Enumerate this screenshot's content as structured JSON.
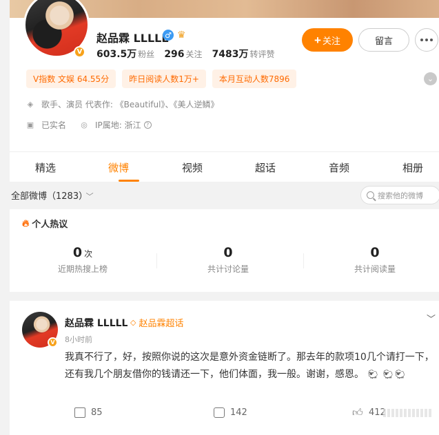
{
  "profile": {
    "name": "赵品霖 LLLLL",
    "v_badge": "V",
    "stats": [
      {
        "num": "603.5万",
        "label": "粉丝"
      },
      {
        "num": "296",
        "label": "关注"
      },
      {
        "num": "7483万",
        "label": "转评赞"
      }
    ],
    "follow_label": "关注",
    "message_label": "留言",
    "tags": [
      "V指数 文娱 64.55分",
      "昨日阅读人数1万+",
      "本月互动人数7896"
    ],
    "description": "歌手、演员 代表作: 《Beautiful》、《美人逆鳞》",
    "verified": "已实名",
    "ip": "IP属地: 浙江"
  },
  "tabs": [
    "精选",
    "微博",
    "视频",
    "超话",
    "音频",
    "相册"
  ],
  "active_tab": "微博",
  "filter": {
    "label": "全部微博（1283）",
    "search_placeholder": "搜索他的微博"
  },
  "hot": {
    "title": "个人热议",
    "items": [
      {
        "num": "0",
        "unit": "次",
        "label": "近期热搜上榜"
      },
      {
        "num": "0",
        "unit": "",
        "label": "共计讨论量"
      },
      {
        "num": "0",
        "unit": "",
        "label": "共计阅读量"
      }
    ]
  },
  "post": {
    "name": "赵品霖 LLLLL",
    "super_topic": "赵品霖超话",
    "time": "8小时前",
    "text": "我真不行了，好，按照你说的这次是意外资金链断了。那去年的款项10几个请打一下，还有我几个朋友借你的钱请还一下，他们体面，我一般。谢谢，感恩。",
    "shares": "85",
    "comments": "142",
    "likes": "412"
  },
  "colors": {
    "accent": "#ff8200",
    "tag_bg": "#fff1e6",
    "verified_blue": "#3d9bf3"
  }
}
